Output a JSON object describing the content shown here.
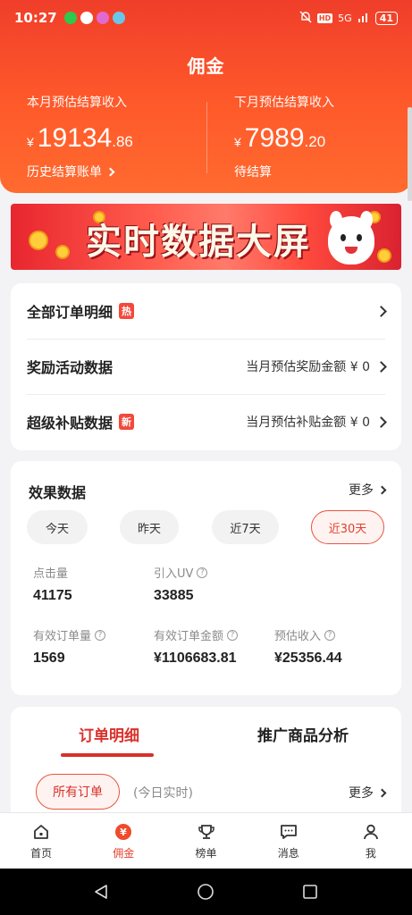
{
  "status_bar": {
    "time": "10:27",
    "battery": "41",
    "network": "5G",
    "hd": "HD"
  },
  "header": {
    "title": "佣金"
  },
  "earnings": {
    "this_month": {
      "label": "本月预估结算收入",
      "currency": "¥",
      "integer": "19134",
      "decimal": ".86",
      "link": "历史结算账单"
    },
    "next_month": {
      "label": "下月预估结算收入",
      "currency": "¥",
      "integer": "7989",
      "decimal": ".20",
      "link": "待结算"
    }
  },
  "banner": {
    "text": "实时数据大屏"
  },
  "menu": {
    "all_orders": {
      "label": "全部订单明细",
      "tag": "热"
    },
    "rewards": {
      "label": "奖励活动数据",
      "right": "当月预估奖励金额 ¥ 0"
    },
    "subsidy": {
      "label": "超级补贴数据",
      "tag": "新",
      "right": "当月预估补贴金额 ¥ 0"
    }
  },
  "effect": {
    "title": "效果数据",
    "more": "更多",
    "filters": [
      "今天",
      "昨天",
      "近7天",
      "近30天"
    ],
    "active_filter": "近30天",
    "metrics": [
      {
        "label": "点击量",
        "value": "41175",
        "help": false
      },
      {
        "label": "引入UV",
        "value": "33885",
        "help": true
      },
      {
        "label": "有效订单量",
        "value": "1569",
        "help": true
      },
      {
        "label": "有效订单金额",
        "value": "¥1106683.81",
        "help": true
      },
      {
        "label": "预估收入",
        "value": "¥25356.44",
        "help": true
      }
    ]
  },
  "orders": {
    "tabs": [
      "订单明细",
      "推广商品分析"
    ],
    "active_tab": "订单明细",
    "filter_all": "所有订单",
    "realtime_note": "(今日实时)",
    "more": "更多"
  },
  "bottom_nav": {
    "items": [
      {
        "label": "首页",
        "icon": "home-icon"
      },
      {
        "label": "佣金",
        "icon": "commission-icon"
      },
      {
        "label": "榜单",
        "icon": "trophy-icon"
      },
      {
        "label": "消息",
        "icon": "message-icon"
      },
      {
        "label": "我",
        "icon": "profile-icon"
      }
    ],
    "active": "佣金"
  },
  "colors": {
    "brand": "#f04a2c",
    "accent_red": "#d9302a",
    "background": "#f3f3f5"
  }
}
